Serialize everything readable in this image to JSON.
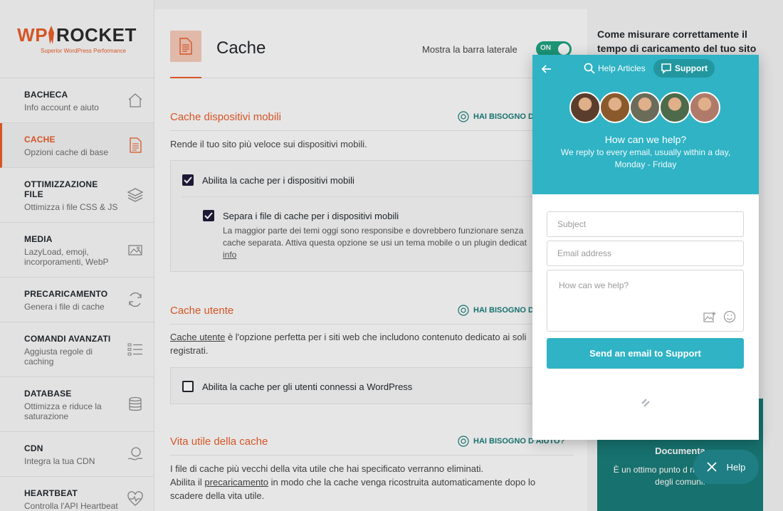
{
  "sidebar": {
    "logo": {
      "main_left": "WP",
      "main_right": "ROCKET",
      "tagline": "Superior WordPress Performance"
    },
    "items": [
      {
        "title": "BACHECA",
        "subtitle": "Info account e aiuto",
        "icon": "home-icon"
      },
      {
        "title": "CACHE",
        "subtitle": "Opzioni cache di base",
        "icon": "document-icon",
        "active": true
      },
      {
        "title": "OTTIMIZZAZIONE FILE",
        "subtitle": "Ottimizza i file CSS & JS",
        "icon": "layers-icon"
      },
      {
        "title": "MEDIA",
        "subtitle": "LazyLoad, emoji, incorporamenti, WebP",
        "icon": "image-icon"
      },
      {
        "title": "PRECARICAMENTO",
        "subtitle": "Genera i file di cache",
        "icon": "refresh-icon"
      },
      {
        "title": "COMANDI AVANZATI",
        "subtitle": "Aggiusta regole di caching",
        "icon": "list-icon"
      },
      {
        "title": "DATABASE",
        "subtitle": "Ottimizza e riduce la saturazione",
        "icon": "database-icon"
      },
      {
        "title": "CDN",
        "subtitle": "Integra la tua CDN",
        "icon": "cdn-icon"
      },
      {
        "title": "HEARTBEAT",
        "subtitle": "Controlla l'API Heartbeat",
        "icon": "heartbeat-icon"
      }
    ]
  },
  "header": {
    "title": "Cache",
    "sidebar_toggle_label": "Mostra la barra laterale",
    "toggle_state": "ON"
  },
  "sections": {
    "mobile": {
      "title": "Cache dispositivi mobili",
      "help": "HAI BISOGNO D",
      "description": "Rende il tuo sito più veloce sui dispositivi mobili.",
      "option1": "Abilita la cache per i dispositivi mobili",
      "option2": "Separa i file di cache per i dispositivi mobili",
      "option2_desc": "La maggior parte dei temi oggi sono responsibe e dovrebbero funzionare senza cache separata. Attiva questa opzione se usi un tema mobile o un plugin dedicat",
      "option2_link": "info"
    },
    "user": {
      "title": "Cache utente",
      "help": "HAI BISOGNO D",
      "description_link": "Cache utente",
      "description": " è l'opzione perfetta per i siti web che includono contenuto dedicato ai soli registrati.",
      "option1": "Abilita la cache per gli utenti connessi a WordPress"
    },
    "lifespan": {
      "title": "Vita utile della cache",
      "help": "HAI BISOGNO D'AIUTO?",
      "desc_line1": "I file di cache più vecchi della vita utile che hai specificato verranno eliminati.",
      "desc_line2_pre": "Abilita il ",
      "desc_line2_link": "precaricamento",
      "desc_line2_post": " in modo che la cache venga ricostruita automaticamente dopo lo scadere della vita utile."
    }
  },
  "right": {
    "title": "Come misurare correttamente il tempo di caricamento del tuo sito",
    "doc_title": "Documenta",
    "doc_text": "È un ottimo punto d   risolvere alcuni degli  comuni."
  },
  "help_fab": {
    "label": "Help"
  },
  "widget": {
    "tab_articles": "Help Articles",
    "tab_support": "Support",
    "heading": "How can we help?",
    "subheading": "We reply to every email, usually within a day, Monday - Friday",
    "subject_placeholder": "Subject",
    "email_placeholder": "Email address",
    "message_placeholder": "How can we help?",
    "send_label": "Send an email to Support",
    "avatar_colors": [
      "#5a3d2b",
      "#8a5a2c",
      "#6b6b5a",
      "#4d6b4a",
      "#b07a6a"
    ]
  },
  "colors": {
    "accent": "#e85d2a",
    "teal": "#1a7b78",
    "widget": "#2fb3c5",
    "toggle_on": "#1ea281"
  }
}
